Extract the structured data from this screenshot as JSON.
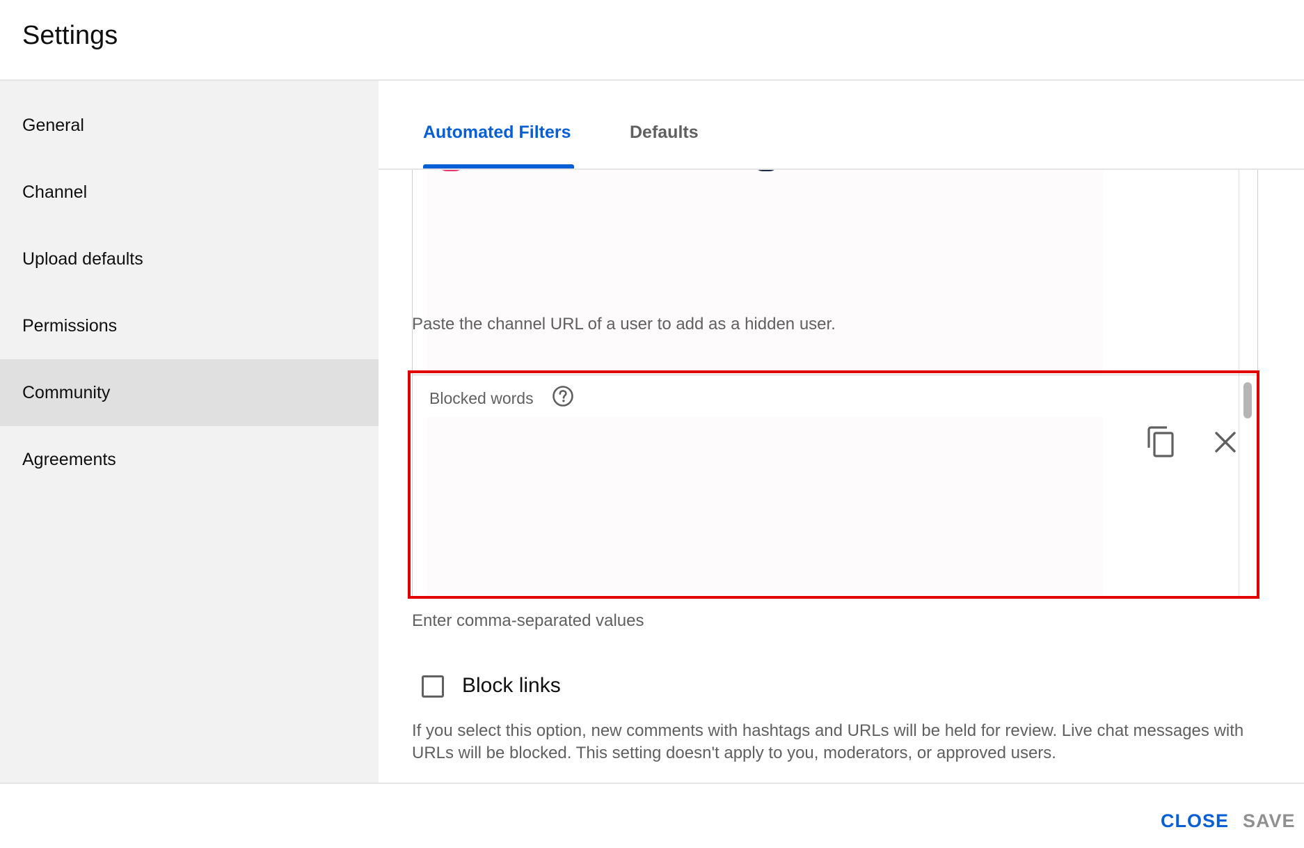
{
  "header": {
    "title": "Settings"
  },
  "sidebar": {
    "items": [
      {
        "label": "General"
      },
      {
        "label": "Channel"
      },
      {
        "label": "Upload defaults"
      },
      {
        "label": "Permissions"
      },
      {
        "label": "Community"
      },
      {
        "label": "Agreements"
      }
    ],
    "active": "Community"
  },
  "tabs": [
    {
      "label": "Automated Filters"
    },
    {
      "label": "Defaults"
    }
  ],
  "hidden_users": {
    "helper": "Paste the channel URL of a user to add as a hidden user."
  },
  "blocked_words": {
    "label": "Blocked words",
    "value": "",
    "helper": "Enter comma-separated values",
    "icons": [
      "help-icon",
      "copy-icon",
      "close-icon"
    ]
  },
  "block_links": {
    "label": "Block links",
    "checked": false,
    "description": "If you select this option, new comments with hashtags and URLs will be held for review. Live chat messages with URLs will be blocked. This setting doesn't apply to you, moderators, or approved users."
  },
  "footer": {
    "close_label": "CLOSE",
    "save_label": "SAVE"
  },
  "colors": {
    "accent": "#065fd4",
    "highlight": "#e00000",
    "sidebar_bg": "#f2f2f2",
    "active_item_bg": "#e0e0e0"
  }
}
